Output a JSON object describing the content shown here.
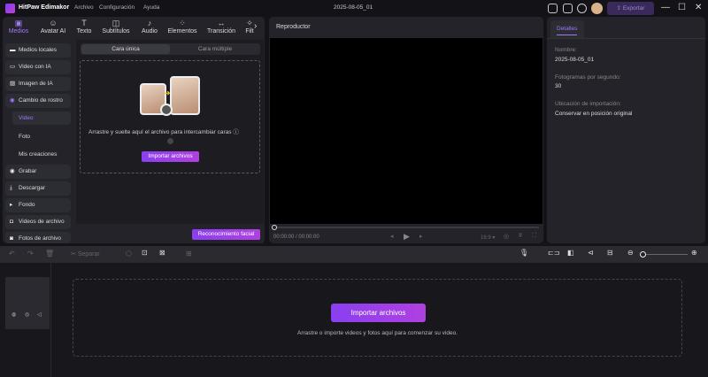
{
  "app": {
    "name": "HitPaw Edimakor",
    "menu": [
      "Archivo",
      "Configuración",
      "Ayuda"
    ],
    "project_title": "2025-08-05_01",
    "export_label": "Exportar"
  },
  "toolbar_tabs": [
    {
      "label": "Medios",
      "icon": "media-icon"
    },
    {
      "label": "Avatar AI",
      "icon": "avatar-icon"
    },
    {
      "label": "Texto",
      "icon": "text-icon"
    },
    {
      "label": "Subtítulos",
      "icon": "subtitles-icon"
    },
    {
      "label": "Audio",
      "icon": "audio-icon"
    },
    {
      "label": "Elementos",
      "icon": "elements-icon"
    },
    {
      "label": "Transición",
      "icon": "transition-icon"
    },
    {
      "label": "Filt",
      "icon": "filter-icon"
    }
  ],
  "sidebar": {
    "items": [
      {
        "label": "Medios locales"
      },
      {
        "label": "Video con IA"
      },
      {
        "label": "Imagen de IA"
      },
      {
        "label": "Cambio de rostro"
      }
    ],
    "subitems": [
      "Video",
      "Foto",
      "Mis creaciones"
    ],
    "items2": [
      {
        "label": "Grabar"
      },
      {
        "label": "Descargar"
      },
      {
        "label": "Fondo"
      },
      {
        "label": "Videos de archivo"
      },
      {
        "label": "Fotos de archivo"
      }
    ]
  },
  "faceswap": {
    "tab_single": "Cara única",
    "tab_multi": "Cara múltiple",
    "drop_text": "Arrastre y suelte aquí el archivo para intercambiar caras",
    "import_label": "Importar archivos",
    "face_recognition_label": "Reconocimiento facial"
  },
  "player": {
    "title": "Reproductor",
    "time_current": "00:00:00",
    "time_total": "00:00:00",
    "aspect": "16:9",
    "progress": 0
  },
  "details": {
    "tab": "Detalles",
    "name_label": "Nombre:",
    "name_value": "2025-08-05_01",
    "fps_label": "Fotogramas por segundo:",
    "fps_value": "30",
    "location_label": "Ubicación de importación:",
    "location_value": "Conservar en posición original"
  },
  "timeline": {
    "split_label": "Separar",
    "import_label": "Importar archivos",
    "hint": "Arrastre o importe videos y fotos aquí para comenzar su video.",
    "zoom_level": 0
  }
}
